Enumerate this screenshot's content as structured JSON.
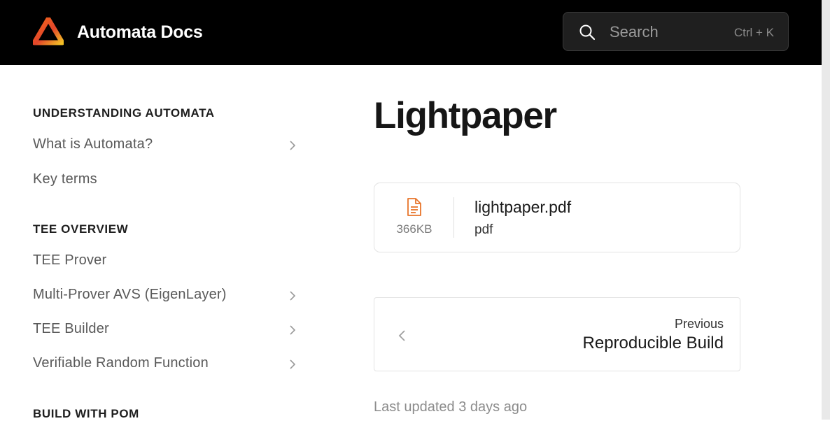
{
  "header": {
    "site_title": "Automata Docs",
    "logo_icon": "automata-triangle-logo",
    "search": {
      "placeholder": "Search",
      "shortcut": "Ctrl + K",
      "icon": "search-icon"
    }
  },
  "sidebar": {
    "sections": [
      {
        "heading": "UNDERSTANDING AUTOMATA",
        "items": [
          {
            "label": "What is Automata?",
            "has_children": true
          },
          {
            "label": "Key terms",
            "has_children": false
          }
        ]
      },
      {
        "heading": "TEE OVERVIEW",
        "items": [
          {
            "label": "TEE Prover",
            "has_children": false
          },
          {
            "label": "Multi-Prover AVS (EigenLayer)",
            "has_children": true
          },
          {
            "label": "TEE Builder",
            "has_children": true
          },
          {
            "label": "Verifiable Random Function",
            "has_children": true
          }
        ]
      },
      {
        "heading": "BUILD WITH POM",
        "items": []
      }
    ]
  },
  "main": {
    "title": "Lightpaper",
    "attachment": {
      "file_name": "lightpaper.pdf",
      "file_type": "pdf",
      "file_size": "366KB",
      "icon": "document-icon"
    },
    "pagination": {
      "previous_label": "Previous",
      "previous_title": "Reproducible Build"
    },
    "last_updated": "Last updated 3 days ago"
  },
  "colors": {
    "header_bg": "#000000",
    "accent_file_icon": "#e8742a"
  }
}
